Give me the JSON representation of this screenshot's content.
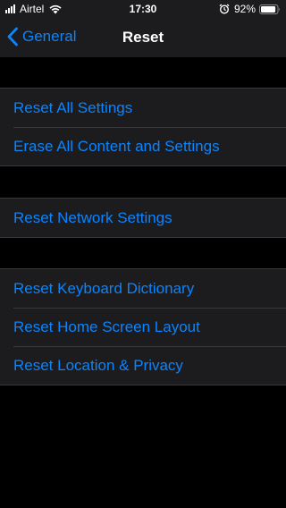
{
  "status_bar": {
    "carrier": "Airtel",
    "time": "17:30",
    "battery": "92%",
    "battery_level": 0.92
  },
  "nav": {
    "back_label": "General",
    "title": "Reset"
  },
  "groups": [
    {
      "items": [
        {
          "label": "Reset All Settings"
        },
        {
          "label": "Erase All Content and Settings"
        }
      ]
    },
    {
      "items": [
        {
          "label": "Reset Network Settings"
        }
      ]
    },
    {
      "items": [
        {
          "label": "Reset Keyboard Dictionary"
        },
        {
          "label": "Reset Home Screen Layout"
        },
        {
          "label": "Reset Location & Privacy"
        }
      ]
    }
  ],
  "colors": {
    "accent": "#0a84ff",
    "background": "#000000",
    "cell": "#1c1c1e",
    "separator": "#38383a"
  },
  "icons": [
    "signal-bars-icon",
    "wifi-icon",
    "alarm-icon",
    "battery-icon",
    "chevron-left-icon"
  ]
}
